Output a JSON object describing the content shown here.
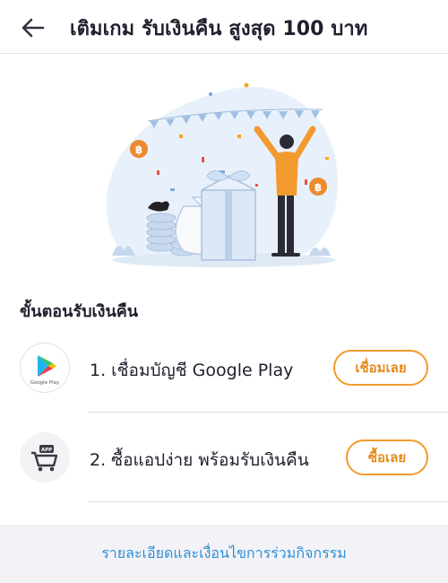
{
  "header": {
    "title": "เติมเกม รับเงินคืน สูงสุด 100 บาท",
    "back_icon": "back-arrow-icon"
  },
  "illustration": {
    "description_icon": "celebration-cashback-illustration"
  },
  "steps": {
    "title": "ขั้นตอนรับเงินคืน",
    "items": [
      {
        "text": "1. เชื่อมบัญชี Google Play",
        "button": "เชื่อมเลย",
        "icon": "google-play-icon",
        "icon_label": "Google Play"
      },
      {
        "text": "2. ซื้อแอปง่าย พร้อมรับเงินคืน",
        "button": "ซื้อเลย",
        "icon": "app-cart-icon",
        "icon_label": "APP"
      }
    ]
  },
  "footer": {
    "link": "รายละเอียดและเงื่อนไขการร่วมกิจกรรม"
  },
  "colors": {
    "accent": "#f29a2e",
    "link": "#2e8fd6",
    "footer_bg": "#f3f3f7"
  }
}
